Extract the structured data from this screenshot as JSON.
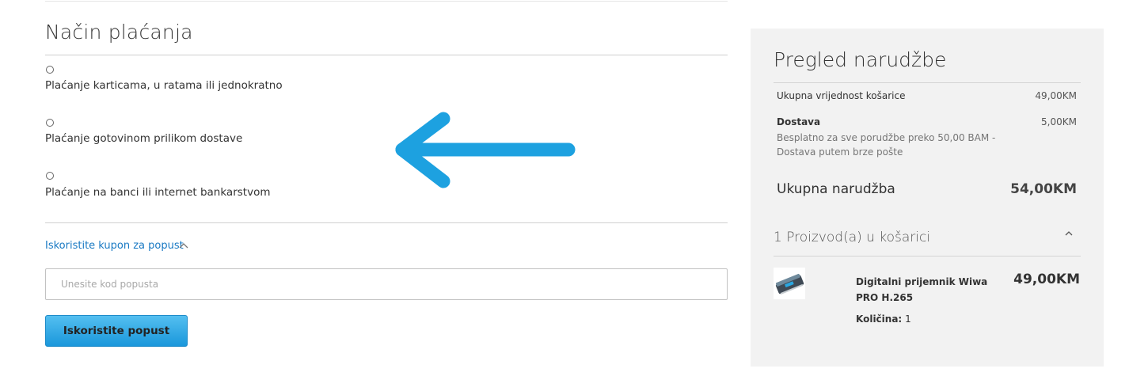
{
  "payment": {
    "title": "Način plaćanja",
    "options": [
      {
        "label": "Plaćanje karticama, u ratama ili jednokratno",
        "selected": false
      },
      {
        "label": "Plaćanje gotovinom prilikom dostave",
        "selected": false
      },
      {
        "label": "Plaćanje na banci ili internet bankarstvom",
        "selected": false
      }
    ]
  },
  "coupon": {
    "toggle_label": "Iskoristite kupon za popust",
    "input_placeholder": "Unesite kod popusta",
    "input_value": "",
    "apply_label": "Iskoristite popust"
  },
  "annotation": {
    "icon": "arrow-left-icon",
    "color": "#1da1e0"
  },
  "summary": {
    "title": "Pregled narudžbe",
    "cart_subtotal_label": "Ukupna vrijednost košarice",
    "cart_subtotal_value": "49,00KM",
    "shipping_label": "Dostava",
    "shipping_note": "Besplatno za sve porudžbe preko 50,00 BAM - Dostava putem brze pošte",
    "shipping_value": "5,00KM",
    "grand_total_label": "Ukupna narudžba",
    "grand_total_value": "54,00KM",
    "items_title": "1 Proizvod(a) u košarici",
    "items": [
      {
        "name": "Digitalni prijemnik Wiwa PRO H.265",
        "price": "49,00KM",
        "qty_label": "Količina:",
        "qty": "1"
      }
    ]
  },
  "colors": {
    "accent_link": "#1979c3",
    "button": "#1a97db",
    "summary_bg": "#f2f2f2"
  }
}
